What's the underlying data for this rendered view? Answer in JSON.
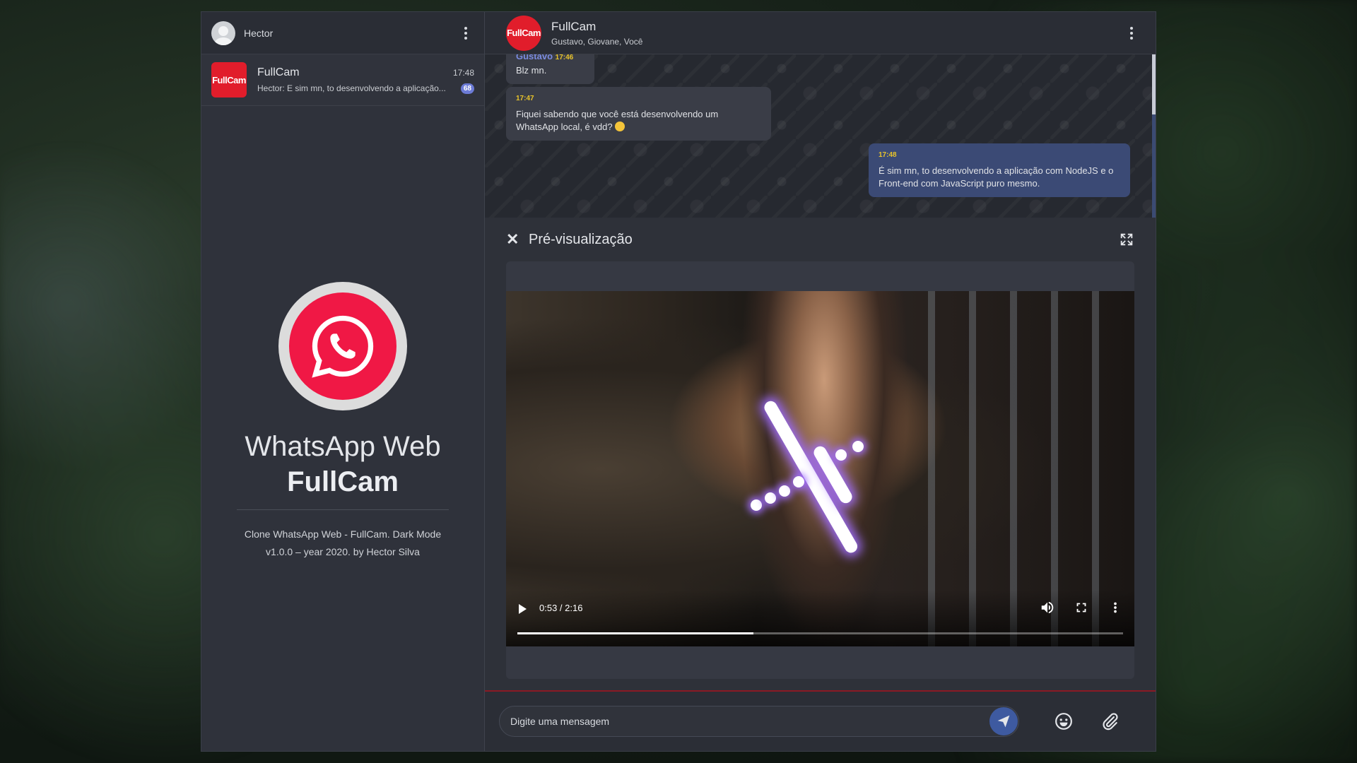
{
  "user": {
    "name": "Hector"
  },
  "chat_list": [
    {
      "name": "FullCam",
      "logo_text": "FullCam",
      "time": "17:48",
      "preview": "Hector: E sim mn, to desenvolvendo a aplicação...",
      "unread": "68"
    }
  ],
  "welcome": {
    "title": "WhatsApp Web",
    "subtitle": "FullCam",
    "desc_line1": "Clone WhatsApp Web - FullCam. Dark Mode",
    "desc_line2": "v1.0.0 – year 2020. by Hector Silva"
  },
  "conversation": {
    "name": "FullCam",
    "avatar_text": "FullCam",
    "members": "Gustavo, Giovane, Você",
    "messages": [
      {
        "sender": "Gustavo",
        "time": "17:46",
        "text": "Blz mn."
      },
      {
        "time": "17:47",
        "text": "Fiquei sabendo que você está desenvolvendo um WhatsApp local, é vdd?",
        "emoji": "thinking-face-icon"
      },
      {
        "time": "17:48",
        "text": "É sim mn, to desenvolvendo a aplicação com NodeJS e o Front-end com JavaScript puro mesmo.",
        "mine": true
      }
    ]
  },
  "preview": {
    "title": "Pré-visualização",
    "video": {
      "time": "0:53 / 2:16",
      "progress_fraction": 0.39
    }
  },
  "composer": {
    "placeholder": "Digite uma mensagem"
  },
  "colors": {
    "brand": "#e11d2b",
    "whatsapp_logo": "#f01845",
    "accent": "#3e5aa0",
    "time": "#e8c32a"
  }
}
